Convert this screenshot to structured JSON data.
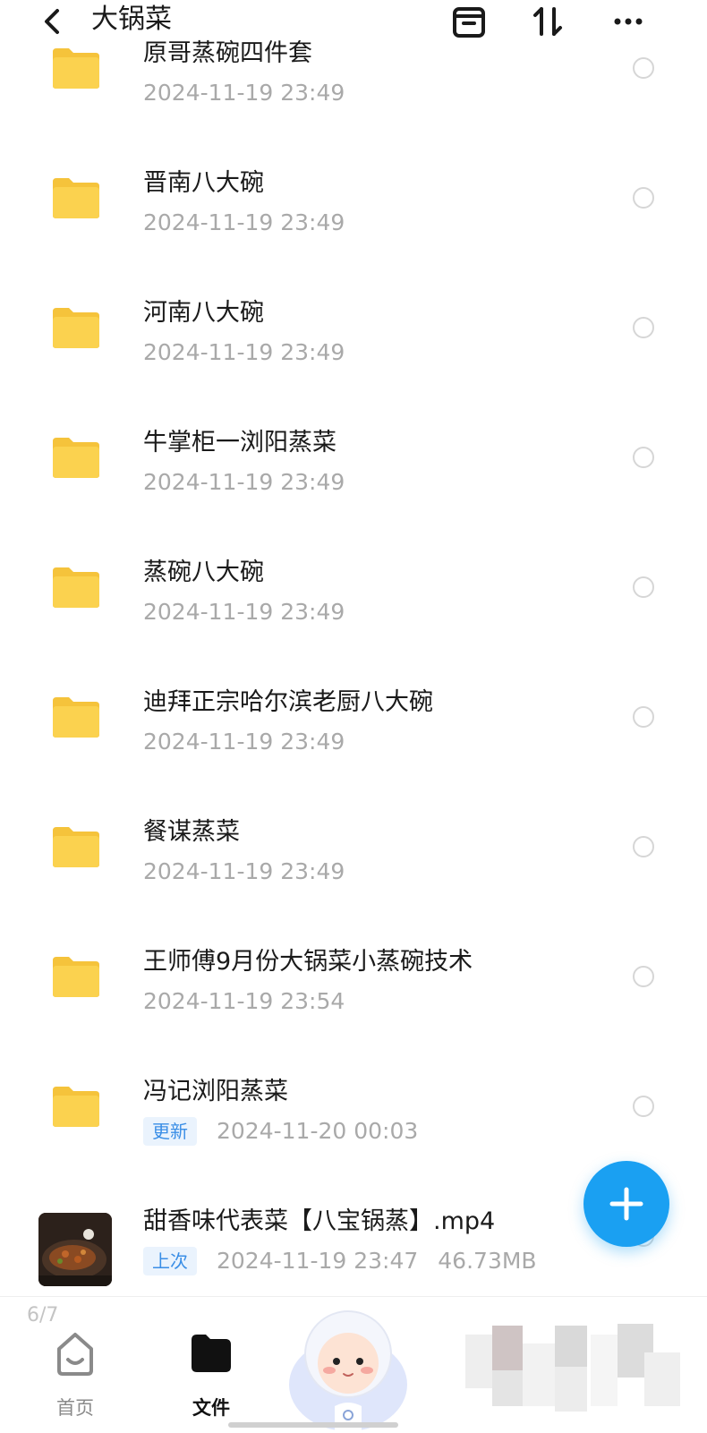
{
  "header": {
    "title": "大锅菜"
  },
  "files": [
    {
      "name": "原哥蒸碗四件套",
      "date": "2024-11-19  23:49",
      "type": "folder"
    },
    {
      "name": "晋南八大碗",
      "date": "2024-11-19  23:49",
      "type": "folder"
    },
    {
      "name": "河南八大碗",
      "date": "2024-11-19  23:49",
      "type": "folder"
    },
    {
      "name": "牛掌柜一浏阳蒸菜",
      "date": "2024-11-19  23:49",
      "type": "folder"
    },
    {
      "name": "蒸碗八大碗",
      "date": "2024-11-19  23:49",
      "type": "folder"
    },
    {
      "name": "迪拜正宗哈尔滨老厨八大碗",
      "date": "2024-11-19  23:49",
      "type": "folder"
    },
    {
      "name": "餐谋蒸菜",
      "date": "2024-11-19  23:49",
      "type": "folder"
    },
    {
      "name": "王师傅9月份大锅菜小蒸碗技术",
      "date": "2024-11-19  23:54",
      "type": "folder"
    },
    {
      "name": "冯记浏阳蒸菜",
      "tag": "更新",
      "date": "2024-11-20  00:03",
      "type": "folder"
    },
    {
      "name": "甜香味代表菜【八宝锅蒸】.mp4",
      "tag": "上次",
      "date": "2024-11-19  23:47",
      "size": "46.73MB",
      "type": "video"
    }
  ],
  "bottom_nav": {
    "page_indicator": "6/7",
    "home_label": "首页",
    "files_label": "文件"
  },
  "colors": {
    "accent": "#1aa0f2",
    "folder": "#fbd24f",
    "tag_bg": "#eaf3fd",
    "tag_text": "#3a8ee6"
  }
}
